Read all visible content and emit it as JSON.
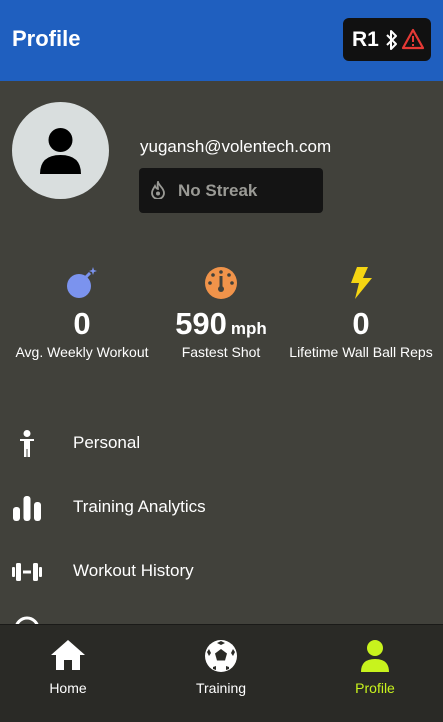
{
  "header": {
    "title": "Profile",
    "device_id": "R1",
    "icons": [
      "bluetooth-icon",
      "warning-icon"
    ]
  },
  "profile": {
    "email": "yugansh@volentech.com",
    "streak_label": "No Streak"
  },
  "stats": [
    {
      "value": "0",
      "unit": "",
      "label": "Avg. Weekly Workout",
      "icon": "bomb-icon"
    },
    {
      "value": "590",
      "unit": "mph",
      "label": "Fastest Shot",
      "icon": "speedometer-icon"
    },
    {
      "value": "0",
      "unit": "",
      "label": "Lifetime Wall Ball Reps",
      "icon": "lightning-icon"
    }
  ],
  "menu": [
    {
      "label": "Personal",
      "icon": "person-icon"
    },
    {
      "label": "Training Analytics",
      "icon": "bar-chart-icon"
    },
    {
      "label": "Workout History",
      "icon": "dumbbell-icon"
    }
  ],
  "bottom_nav": [
    {
      "label": "Home",
      "icon": "home-icon"
    },
    {
      "label": "Training",
      "icon": "soccer-ball-icon"
    },
    {
      "label": "Profile",
      "icon": "profile-icon",
      "active": true
    }
  ],
  "colors": {
    "header_bg": "#1f5fbf",
    "background": "#41413b",
    "nav_bg": "#2a2a26",
    "accent": "#c8f31d",
    "bomb": "#7b93ee",
    "speedometer": "#f0934a",
    "lightning": "#f5d512"
  }
}
